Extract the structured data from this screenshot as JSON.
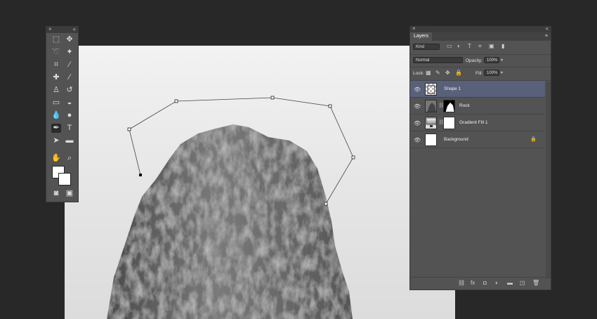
{
  "tools_panel": {
    "close": "×",
    "collapse": "«",
    "tools": [
      {
        "name": "marquee-tool",
        "glyph": "⬚"
      },
      {
        "name": "move-tool",
        "glyph": "✥"
      },
      {
        "name": "lasso-tool",
        "glyph": "➰"
      },
      {
        "name": "magic-wand-tool",
        "glyph": "✦"
      },
      {
        "name": "crop-tool",
        "glyph": "⌗"
      },
      {
        "name": "eyedropper-tool",
        "glyph": "⁄"
      },
      {
        "name": "healing-brush-tool",
        "glyph": "✚"
      },
      {
        "name": "brush-tool",
        "glyph": "∕"
      },
      {
        "name": "clone-stamp-tool",
        "glyph": "♙"
      },
      {
        "name": "history-brush-tool",
        "glyph": "↺"
      },
      {
        "name": "eraser-tool",
        "glyph": "▭"
      },
      {
        "name": "paint-bucket-tool",
        "glyph": "◒"
      },
      {
        "name": "blur-tool",
        "glyph": "💧"
      },
      {
        "name": "dodge-tool",
        "glyph": "●"
      },
      {
        "name": "pen-tool",
        "glyph": "✒"
      },
      {
        "name": "type-tool",
        "glyph": "T"
      },
      {
        "name": "path-selection-tool",
        "glyph": "➤"
      },
      {
        "name": "rectangle-tool",
        "glyph": "▬"
      },
      {
        "name": "hand-tool",
        "glyph": "✋"
      },
      {
        "name": "zoom-tool",
        "glyph": "⌕"
      },
      {
        "name": "quick-mask-tool",
        "glyph": "◙"
      },
      {
        "name": "screen-mode-tool",
        "glyph": "▣"
      }
    ]
  },
  "layers_panel": {
    "close": "×",
    "collapse": "«",
    "tab_label": "Layers",
    "menu_icon": "≡",
    "filter_kind": "Kind",
    "filter_icons": [
      "▭",
      "◐",
      "T",
      "⌗",
      "▣",
      "▮"
    ],
    "blend_mode": "Normal",
    "opacity_label": "Opacity:",
    "opacity_value": "100%",
    "lock_label": "Lock:",
    "lock_icons": [
      "▦",
      "✎",
      "✥",
      "🔒"
    ],
    "fill_label": "Fill:",
    "fill_value": "100%",
    "layers": [
      {
        "name": "Shape 1",
        "active": true
      },
      {
        "name": "Rock",
        "active": false
      },
      {
        "name": "Gradient Fill 1",
        "active": false
      },
      {
        "name": "Background",
        "active": false,
        "locked_icon": "🔒"
      }
    ],
    "footer_icons": [
      "⛓",
      "fx",
      "◘",
      "◐",
      "▬",
      "◳",
      "🗑"
    ]
  }
}
